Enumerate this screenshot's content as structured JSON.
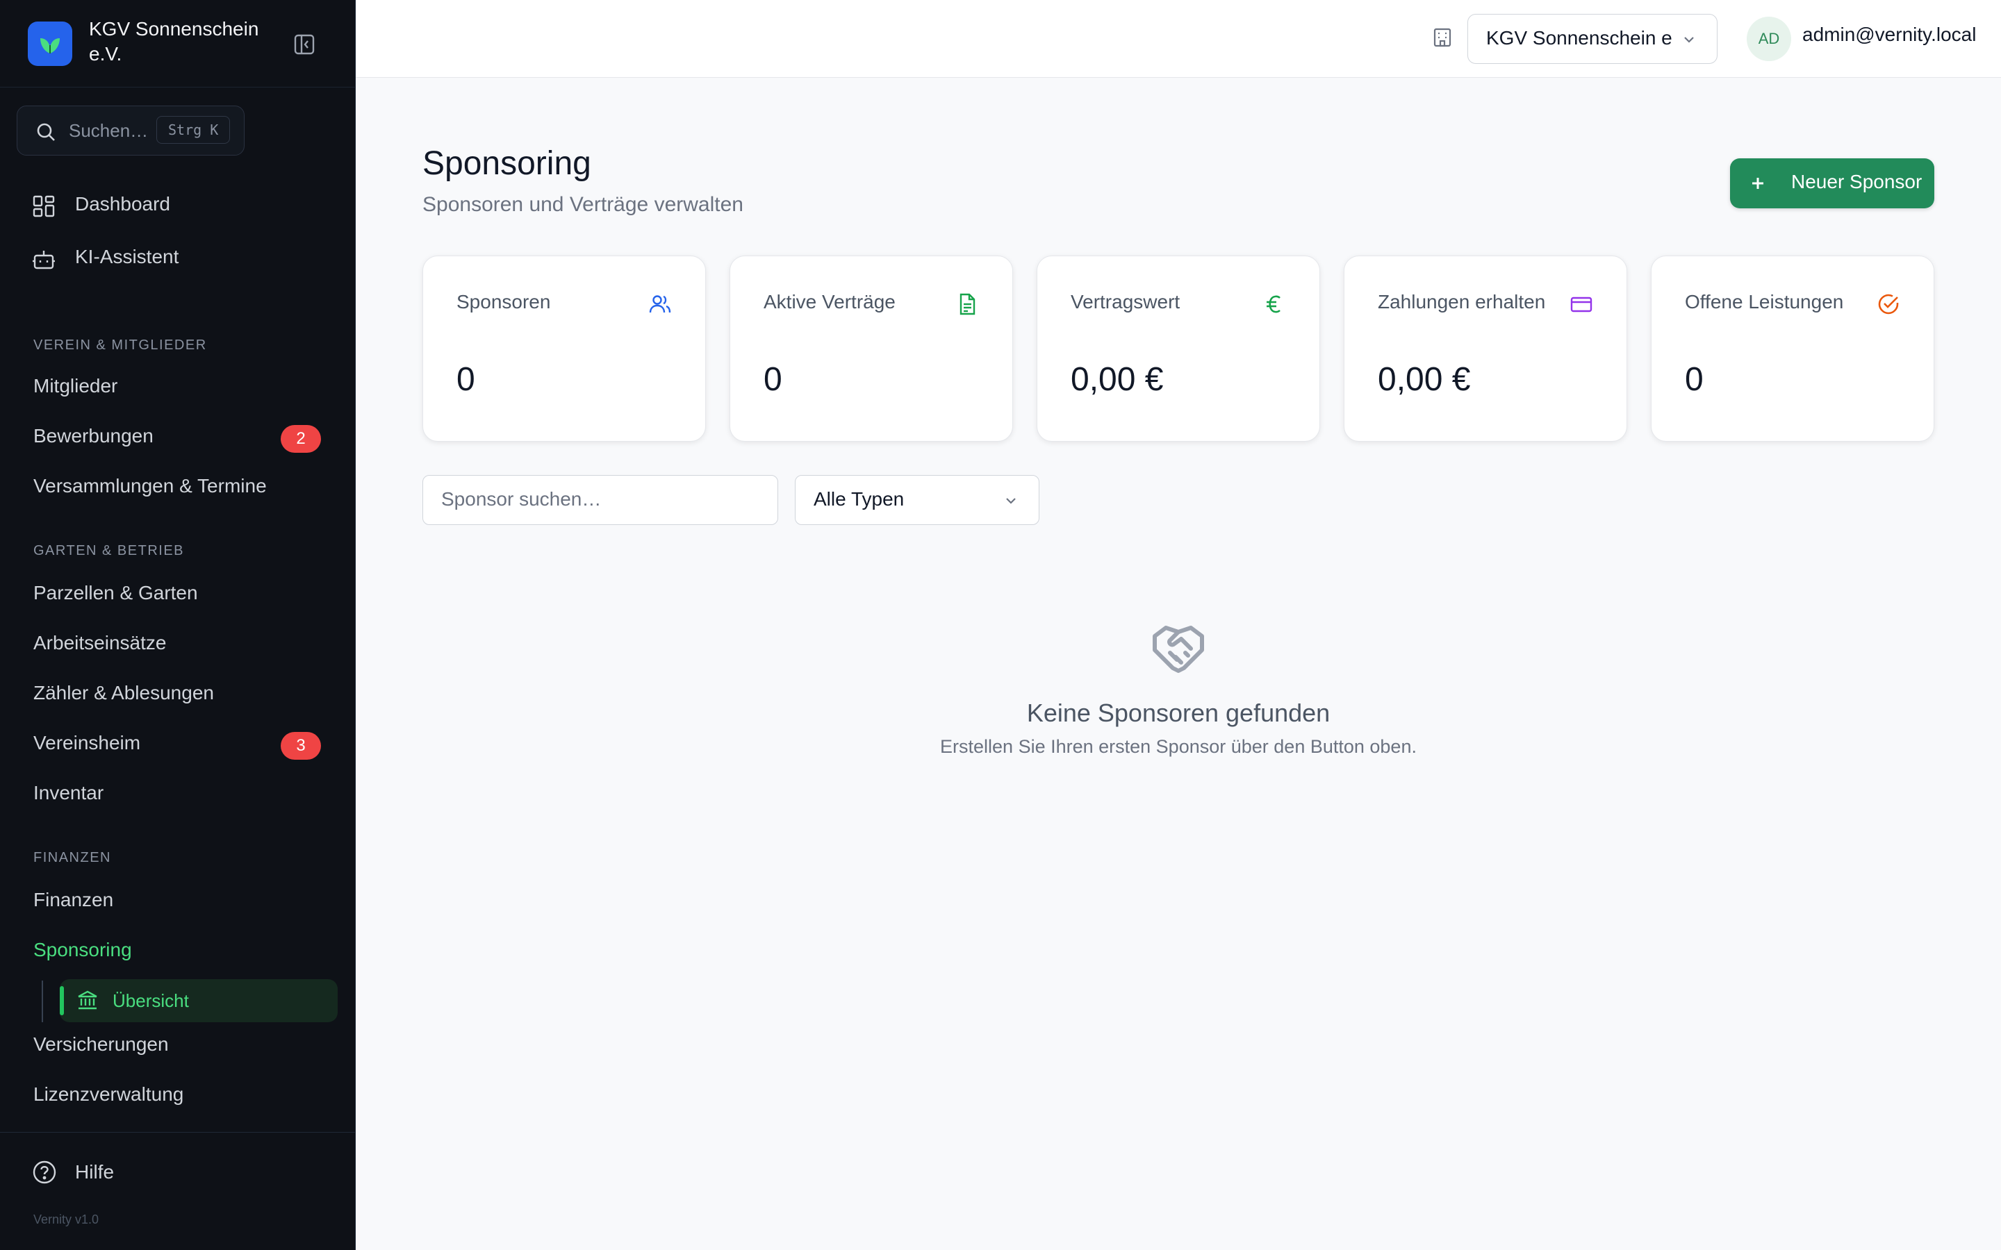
{
  "brand": {
    "name": "KGV Sonnenschein e.V.",
    "logo_color": "#2563eb"
  },
  "search": {
    "placeholder": "Suchen…",
    "shortcut": "Strg K"
  },
  "nav": {
    "dashboard": "Dashboard",
    "assistant": "KI-Assistent",
    "sections": [
      {
        "title": "Verein & Mitglieder",
        "items": [
          {
            "label": "Mitglieder"
          },
          {
            "label": "Bewerbungen",
            "badge": "2"
          },
          {
            "label": "Versammlungen & Termine"
          }
        ]
      },
      {
        "title": "Garten & Betrieb",
        "items": [
          {
            "label": "Parzellen & Garten"
          },
          {
            "label": "Arbeitseinsätze"
          },
          {
            "label": "Zähler & Ablesungen"
          },
          {
            "label": "Vereinsheim",
            "badge": "3"
          },
          {
            "label": "Inventar"
          }
        ]
      },
      {
        "title": "Finanzen",
        "items": [
          {
            "label": "Finanzen"
          },
          {
            "label": "Sponsoring",
            "active": true
          },
          {
            "label": "Versicherungen"
          },
          {
            "label": "Lizenzverwaltung"
          }
        ]
      }
    ],
    "sponsoring_sub": {
      "label": "Übersicht"
    },
    "help": "Hilfe",
    "version": "Vernity v1.0"
  },
  "topbar": {
    "org_select": "KGV Sonnenschein e.V.",
    "avatar_initials": "AD",
    "user_email": "admin@vernity.local"
  },
  "page": {
    "title": "Sponsoring",
    "subtitle": "Sponsoren und Verträge verwalten",
    "new_button": "Neuer Sponsor",
    "accent": "#228b5a"
  },
  "stats": [
    {
      "label": "Sponsoren",
      "value": "0",
      "icon": "users-icon",
      "color": "#2563eb"
    },
    {
      "label": "Aktive Verträge",
      "value": "0",
      "icon": "file-text-icon",
      "color": "#16a34a"
    },
    {
      "label": "Vertragswert",
      "value": "0,00 €",
      "icon": "euro-icon",
      "color": "#16a34a"
    },
    {
      "label": "Zahlungen erhalten",
      "value": "0,00 €",
      "icon": "credit-card-icon",
      "color": "#9333ea"
    },
    {
      "label": "Offene Leistungen",
      "value": "0",
      "icon": "check-circle-icon",
      "color": "#ea580c"
    }
  ],
  "filters": {
    "search_placeholder": "Sponsor suchen…",
    "type_select": "Alle Typen"
  },
  "empty_state": {
    "icon": "handshake-icon",
    "title": "Keine Sponsoren gefunden",
    "text": "Erstellen Sie Ihren ersten Sponsor über den Button oben."
  }
}
